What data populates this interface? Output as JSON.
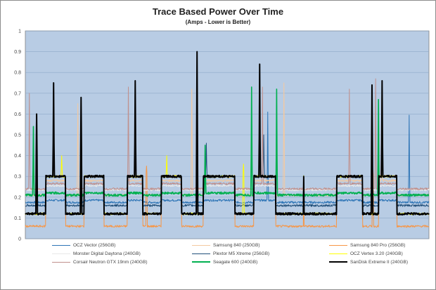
{
  "chart_data": {
    "type": "line",
    "title": "Trace Based Power Over Time",
    "subtitle": "(Amps - Lower is Better)",
    "xlabel": "",
    "ylabel": "",
    "ylim": [
      0,
      1
    ],
    "yticks": [
      "0",
      "0.1",
      "0.2",
      "0.3",
      "0.4",
      "0.5",
      "0.6",
      "0.7",
      "0.8",
      "0.9",
      "1"
    ],
    "grid": true,
    "plot_background": "#b8cce4",
    "legend_position": "bottom",
    "x_points": 1000,
    "idle_segments": [
      [
        0,
        50
      ],
      [
        100,
        145
      ],
      [
        195,
        252
      ],
      [
        291,
        336
      ],
      [
        387,
        440
      ],
      [
        519,
        565
      ],
      [
        620,
        688
      ],
      [
        690,
        770
      ],
      [
        835,
        874
      ],
      [
        920,
        1000
      ]
    ],
    "series": [
      {
        "name": "OCZ Vector (256GB)",
        "color": "#2e75b6",
        "base": 0.175,
        "active": 0.185,
        "spikes": [
          [
            600,
            0.61
          ],
          [
            950,
            0.595
          ]
        ]
      },
      {
        "name": "Samsung 840 (250GB)",
        "color": "#f4c9a0",
        "base": 0.21,
        "active": 0.28,
        "spikes": [
          [
            130,
            0.65
          ],
          [
            412,
            0.72
          ],
          [
            640,
            0.75
          ],
          [
            882,
            0.68
          ]
        ]
      },
      {
        "name": "Samsung 840 Pro (256GB)",
        "color": "#f79646",
        "base": 0.06,
        "active": 0.3,
        "spikes": [
          [
            300,
            0.35
          ],
          [
            860,
            0.33
          ]
        ]
      },
      {
        "name": "Monster Digital Daytona (240GB)",
        "color": "#e8e8e8",
        "base": 0.235,
        "active": 0.255,
        "spikes": []
      },
      {
        "name": "Plextor M5 Xtreme (256GB)",
        "color": "#1f4e79",
        "base": 0.16,
        "active": 0.3,
        "spikes": [
          [
            448,
            0.46
          ],
          [
            590,
            0.5
          ]
        ]
      },
      {
        "name": "OCZ Vertex 3.20 (240GB)",
        "color": "#ffff00",
        "base": 0.12,
        "active": 0.3,
        "spikes": [
          [
            90,
            0.4
          ],
          [
            350,
            0.4
          ],
          [
            540,
            0.36
          ]
        ]
      },
      {
        "name": "Corsair Neutron GTX 19nm (240GB)",
        "color": "#c0908c",
        "base": 0.24,
        "active": 0.265,
        "spikes": [
          [
            10,
            0.7
          ],
          [
            255,
            0.73
          ],
          [
            425,
            0.86
          ],
          [
            587,
            0.73
          ],
          [
            802,
            0.72
          ],
          [
            867,
            0.77
          ]
        ]
      },
      {
        "name": "Seagate 600 (240GB)",
        "color": "#00b050",
        "base": 0.21,
        "active": 0.22,
        "spikes": [
          [
            20,
            0.54
          ],
          [
            445,
            0.45
          ],
          [
            560,
            0.73
          ],
          [
            622,
            0.72
          ],
          [
            874,
            0.67
          ]
        ]
      },
      {
        "name": "SanDisk Extreme II (240GB)",
        "color": "#000000",
        "base": 0.12,
        "active": 0.3,
        "spikes": [
          [
            28,
            0.6
          ],
          [
            70,
            0.75
          ],
          [
            138,
            0.68
          ],
          [
            272,
            0.76
          ],
          [
            425,
            0.9
          ],
          [
            580,
            0.84
          ],
          [
            858,
            0.74
          ],
          [
            883,
            0.76
          ]
        ]
      }
    ]
  }
}
